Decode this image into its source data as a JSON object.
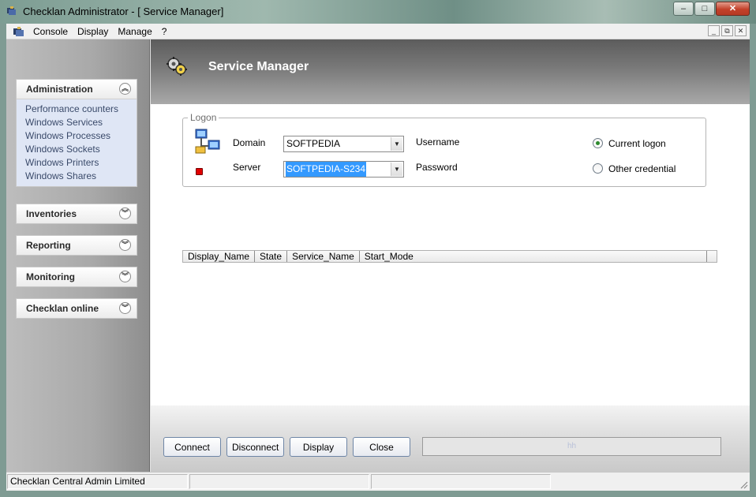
{
  "window": {
    "title": "Checklan Administrator - [ Service Manager]",
    "min_label": "–",
    "max_label": "□",
    "close_label": "✕"
  },
  "menu": {
    "items": [
      "Console",
      "Display",
      "Manage",
      "?"
    ]
  },
  "sidebar": {
    "administration": {
      "title": "Administration",
      "links": [
        "Performance counters",
        "Windows Services",
        "Windows Processes",
        "Windows Sockets",
        "Windows Printers",
        "Windows Shares"
      ]
    },
    "inventories": "Inventories",
    "reporting": "Reporting",
    "monitoring": "Monitoring",
    "checklan_online": "Checklan online"
  },
  "main": {
    "title": "Service Manager",
    "logon": {
      "legend": "Logon",
      "domain_label": "Domain",
      "domain_value": "SOFTPEDIA",
      "server_label": "Server",
      "server_value": "SOFTPEDIA-S234",
      "username_label": "Username",
      "password_label": "Password",
      "current_logon_label": "Current logon",
      "other_credential_label": "Other credential",
      "selected_option": "Current logon"
    },
    "grid": {
      "columns": [
        "Display_Name",
        "State",
        "Service_Name",
        "Start_Mode"
      ]
    },
    "buttons": {
      "connect": "Connect",
      "disconnect": "Disconnect",
      "display": "Display",
      "close": "Close"
    },
    "progress_text": "hh"
  },
  "statusbar": {
    "text": "Checklan Central Admin Limited"
  },
  "colors": {
    "header_band": "#7a7a7a",
    "panel_body": "#dfe6f5",
    "status_dot": "#e10000",
    "button_border": "#6f86a6"
  }
}
